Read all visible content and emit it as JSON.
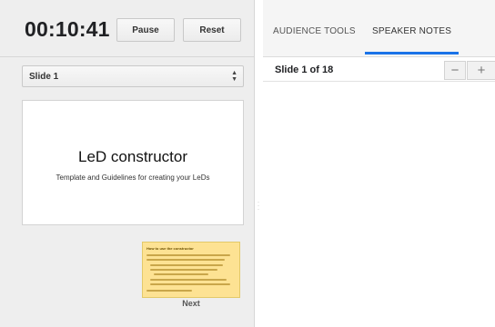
{
  "timer": {
    "time": "00:10:41",
    "pause_label": "Pause",
    "reset_label": "Reset"
  },
  "slide_selector": {
    "selected": "Slide 1"
  },
  "current_slide": {
    "title": "LeD constructor",
    "subtitle": "Template and Guidelines for creating your LeDs"
  },
  "next_slide": {
    "thumb_title": "How to use the constructor",
    "label": "Next"
  },
  "tabs": [
    {
      "label": "AUDIENCE TOOLS",
      "active": false
    },
    {
      "label": "SPEAKER NOTES",
      "active": true
    }
  ],
  "notes": {
    "slide_count": "Slide 1 of 18",
    "zoom_out_symbol": "−",
    "zoom_in_symbol": "+"
  },
  "colors": {
    "accent": "#1a73e8",
    "thumb_background": "#fde293"
  },
  "icons": {
    "select_arrows": "up-down-arrows-icon",
    "zoom_out": "minus-icon",
    "zoom_in": "plus-icon",
    "divider_handle": "drag-handle-icon"
  }
}
